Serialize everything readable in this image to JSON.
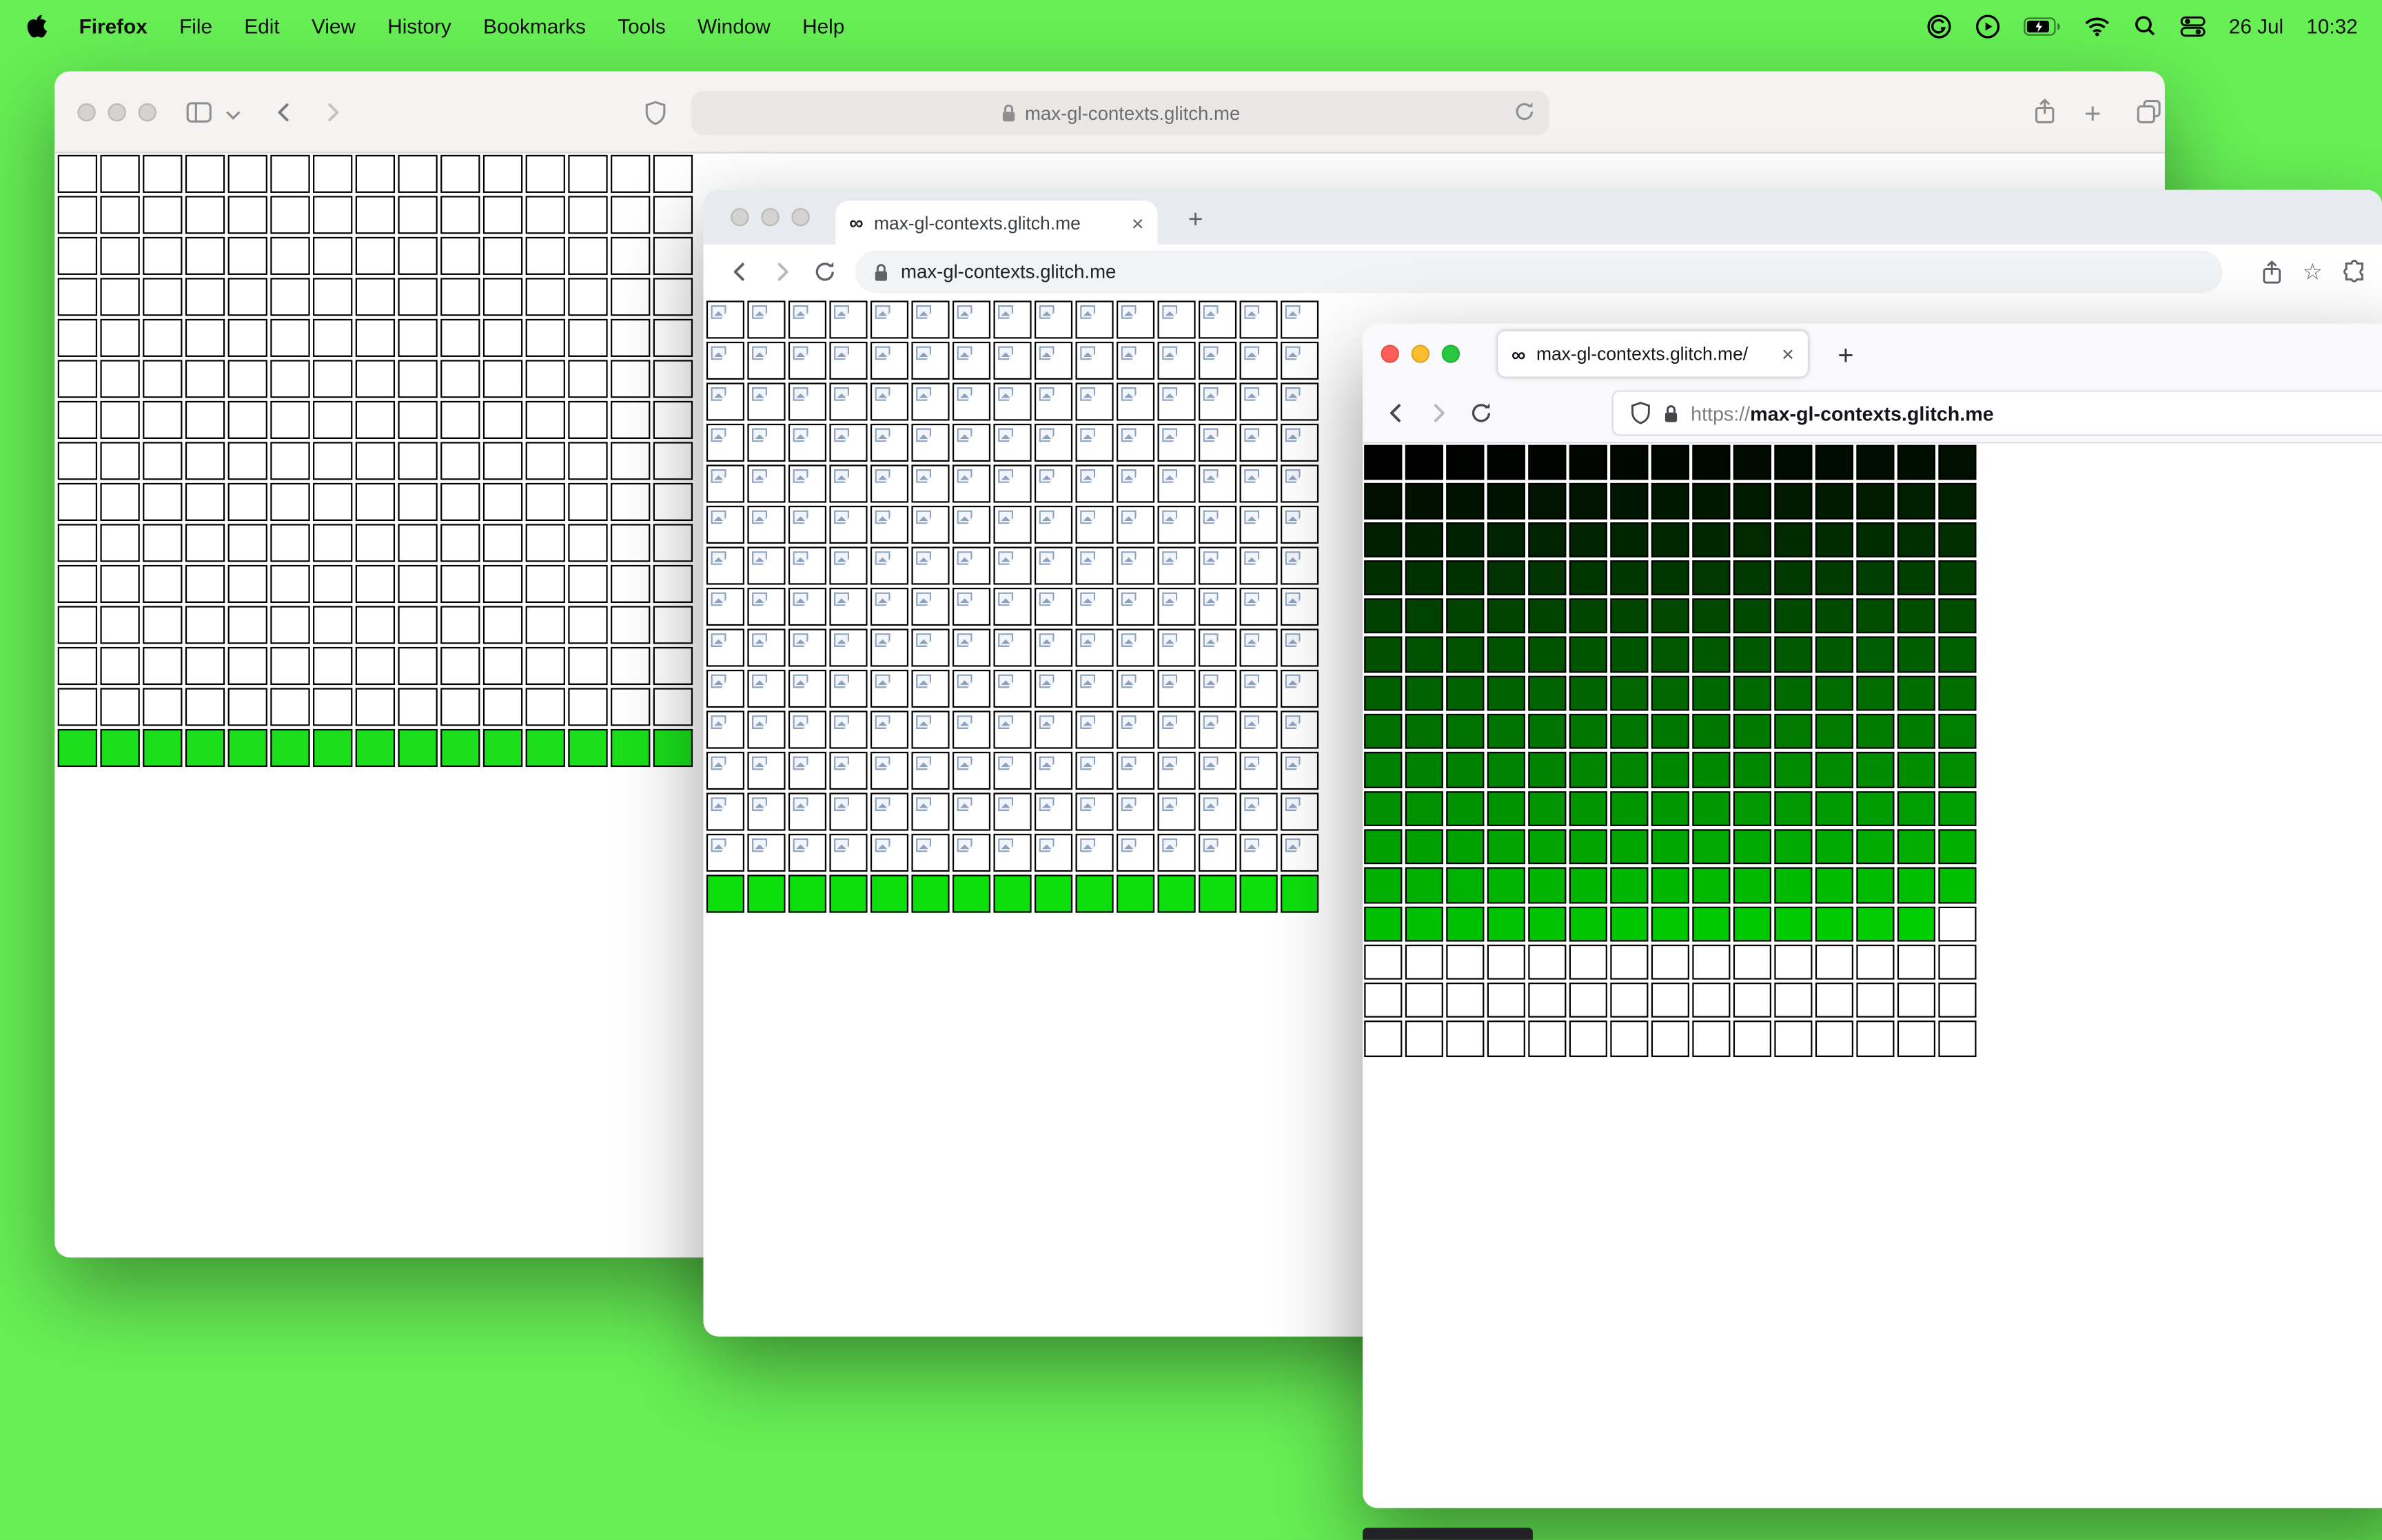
{
  "menubar": {
    "app_name": "Firefox",
    "menus": [
      "File",
      "Edit",
      "View",
      "History",
      "Bookmarks",
      "Tools",
      "Window",
      "Help"
    ],
    "date": "26 Jul",
    "time": "10:32"
  },
  "safari_window": {
    "url": "max-gl-contexts.glitch.me",
    "grid": {
      "cols": 15,
      "rows": 15,
      "bottom_green_rows": 1,
      "green_color": "#1adf1a",
      "cell_style": "blank"
    }
  },
  "chrome_window": {
    "tab": {
      "favicon": "∞",
      "title": "max-gl-contexts.glitch.me",
      "close": "×"
    },
    "new_tab_label": "+",
    "url": "max-gl-contexts.glitch.me",
    "bookmark_star": "☆",
    "grid": {
      "cols": 15,
      "rows": 15,
      "bottom_green_rows": 1,
      "green_color": "#0ddf0d",
      "cell_style": "broken-image"
    }
  },
  "firefox_window": {
    "tab": {
      "favicon": "∞",
      "title": "max-gl-contexts.glitch.me/",
      "close": "×"
    },
    "new_tab_label": "+",
    "url_scheme": "https://",
    "url_host": "max-gl-contexts.glitch.me",
    "grid": {
      "cols": 15,
      "rows": 16,
      "filled_cells": 194,
      "ramp_scale": 255,
      "ramp_denominator": 240,
      "cell_style": "green-ramp"
    }
  }
}
